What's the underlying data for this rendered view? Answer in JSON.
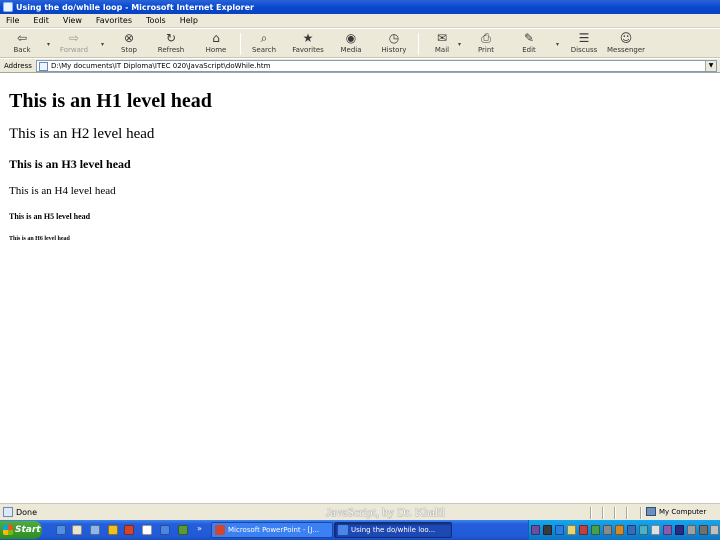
{
  "window": {
    "title": "Using the do/while loop - Microsoft Internet Explorer"
  },
  "menu": [
    "File",
    "Edit",
    "View",
    "Favorites",
    "Tools",
    "Help"
  ],
  "toolbar": {
    "buttons": [
      {
        "label": "Back",
        "icon": "back-arrow-icon"
      },
      {
        "label": "Forward",
        "icon": "forward-arrow-icon"
      },
      {
        "label": "Stop",
        "icon": "stop-icon"
      },
      {
        "label": "Refresh",
        "icon": "refresh-icon"
      },
      {
        "label": "Home",
        "icon": "home-icon"
      },
      {
        "label": "Search",
        "icon": "search-icon"
      },
      {
        "label": "Favorites",
        "icon": "favorites-icon"
      },
      {
        "label": "Media",
        "icon": "media-icon"
      },
      {
        "label": "History",
        "icon": "history-icon"
      },
      {
        "label": "Mail",
        "icon": "mail-icon"
      },
      {
        "label": "Print",
        "icon": "print-icon"
      },
      {
        "label": "Edit",
        "icon": "edit-icon"
      },
      {
        "label": "Discuss",
        "icon": "discuss-icon"
      },
      {
        "label": "Messenger",
        "icon": "messenger-icon"
      }
    ]
  },
  "address": {
    "label": "Address",
    "value": "D:\\My documents\\IT Diploma\\ITEC 020\\JavaScript\\doWhile.htm"
  },
  "content": {
    "h1": "This is an H1 level head",
    "h2": "This is an H2 level head",
    "h3": "This is an H3 level head",
    "h4": "This is an H4 level head",
    "h5": "This is an H5 level head",
    "h6": "This is an H6 level head"
  },
  "status": {
    "text": "Done",
    "credit": "JavaScript, by Dr. Khalil",
    "zone": "My Computer"
  },
  "taskbar": {
    "start": "Start",
    "tasks": [
      {
        "label": "Microsoft PowerPoint - [J...",
        "active": false
      },
      {
        "label": "Using the do/while loo...",
        "active": true
      }
    ]
  }
}
